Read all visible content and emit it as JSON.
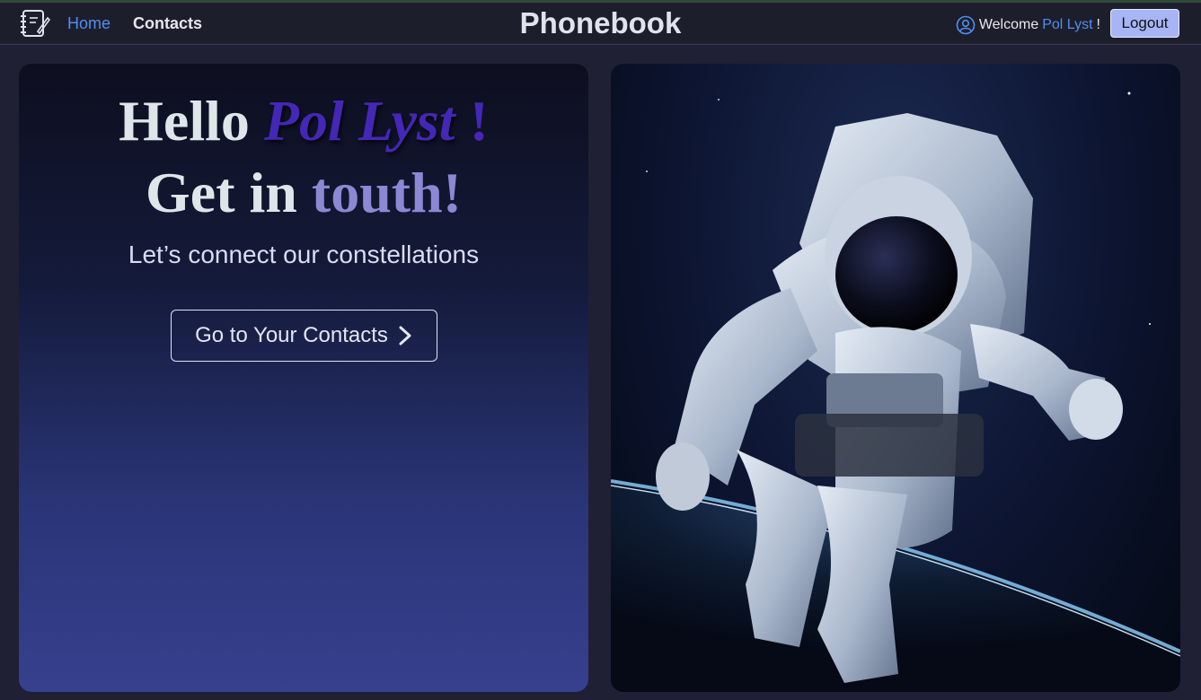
{
  "header": {
    "logo_icon": "notebook-icon",
    "nav": {
      "home": "Home",
      "contacts": "Contacts"
    },
    "brand": "Phonebook",
    "welcome_prefix": "Welcome",
    "username": "Pol Lyst",
    "welcome_suffix": "!",
    "user_icon": "user-circle-icon",
    "logout": "Logout",
    "colors": {
      "active_link": "#4f8ff0",
      "logout_bg": "#a7b5f5"
    }
  },
  "hero": {
    "hello": "Hello",
    "name": "Pol Lyst",
    "excl": "!",
    "get_in": "Get in",
    "touch": "touth!",
    "tagline": "Let’s connect our constellations",
    "cta_label": "Go to Your Contacts",
    "cta_icon": "chevron-right-icon",
    "colors": {
      "name": "#4427b6",
      "touch": "#8b88d4"
    }
  },
  "image": {
    "subject": "astronaut-image"
  }
}
